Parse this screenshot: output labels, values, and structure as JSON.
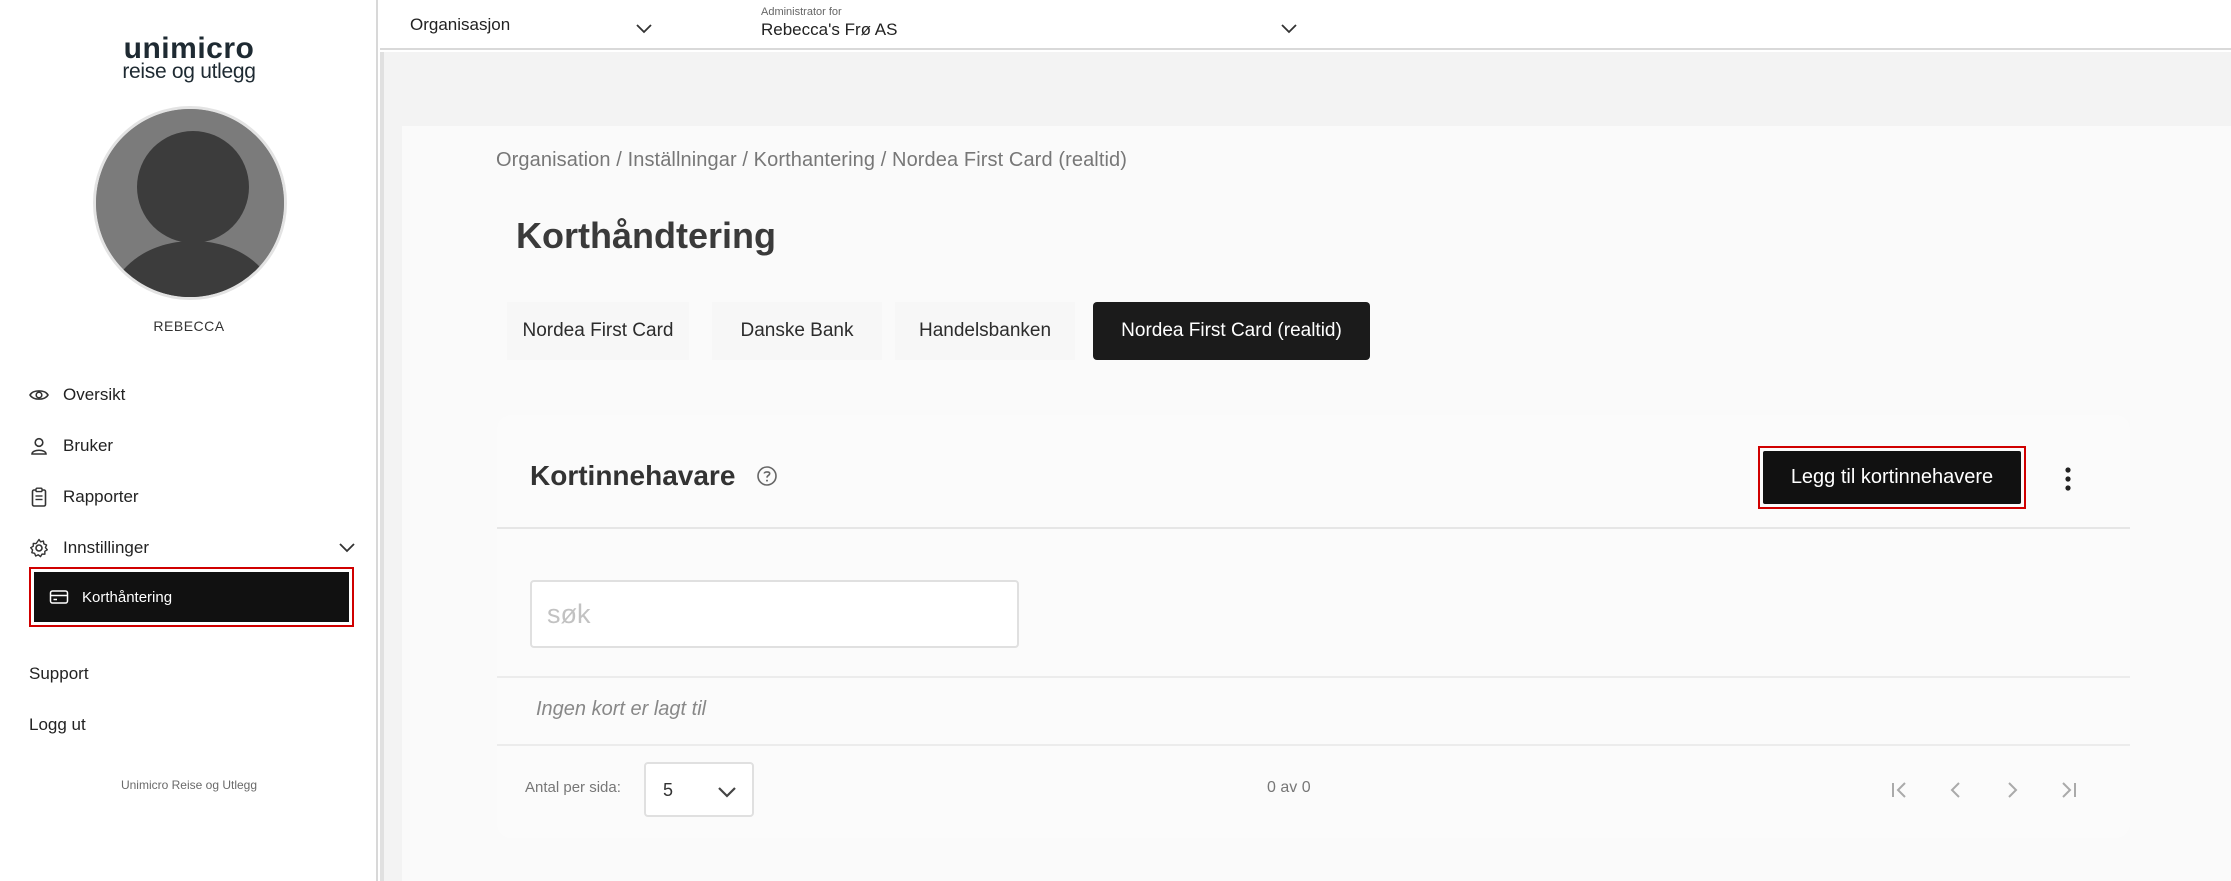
{
  "sidebar": {
    "logo_main": "unimicro",
    "logo_sub": "reise og utlegg",
    "username": "REBECCA",
    "items": [
      {
        "label": "Oversikt",
        "icon": "eye-icon"
      },
      {
        "label": "Bruker",
        "icon": "user-icon"
      },
      {
        "label": "Rapporter",
        "icon": "clipboard-icon"
      },
      {
        "label": "Innstillinger",
        "icon": "gear-icon"
      }
    ],
    "sub_item": {
      "label": "Korthåntering",
      "icon": "credit-card-icon"
    },
    "support": "Support",
    "logout": "Logg ut",
    "footer": "Unimicro Reise og Utlegg"
  },
  "topbar": {
    "org_select": "Organisasjon",
    "admin_label": "Administrator for",
    "admin_value": "Rebecca's Frø AS"
  },
  "breadcrumb": "Organisation / Inställningar / Korthantering / Nordea First Card (realtid)",
  "page_title": "Korthåndtering",
  "tabs": [
    {
      "label": "Nordea First Card",
      "active": false
    },
    {
      "label": "Danske Bank",
      "active": false
    },
    {
      "label": "Handelsbanken",
      "active": false
    },
    {
      "label": "Nordea First Card (realtid)",
      "active": true
    }
  ],
  "card": {
    "title": "Kortinnehavare",
    "add_button": "Legg til kortinnehavere",
    "search_placeholder": "søk",
    "empty_message": "Ingen kort er lagt til",
    "per_page_label": "Antal per sida:",
    "per_page_value": "5",
    "count_text": "0 av 0"
  },
  "colors": {
    "accent_dark": "#111111",
    "highlight_red": "#d00000"
  }
}
